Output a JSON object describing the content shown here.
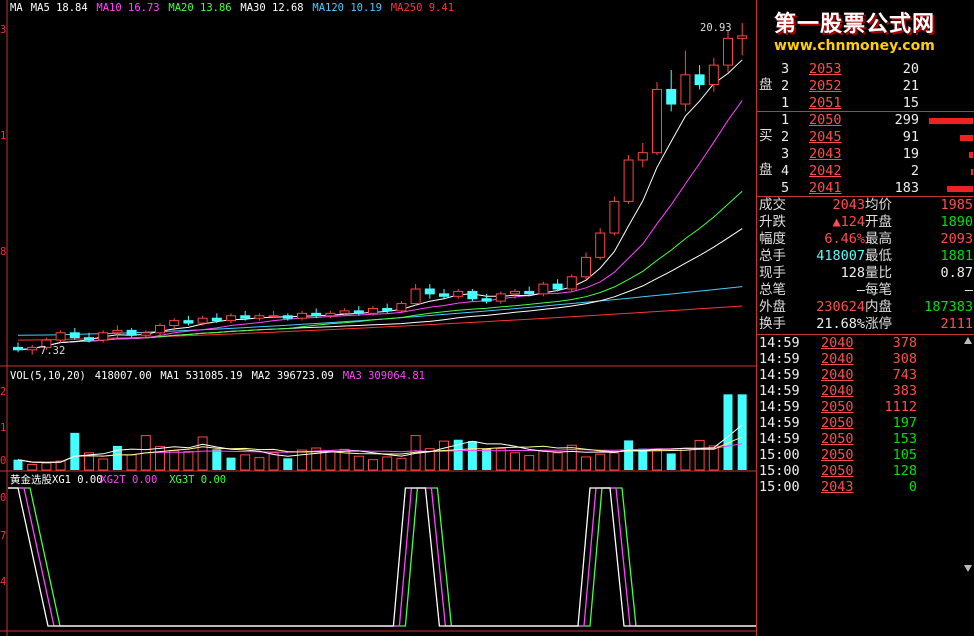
{
  "colors": {
    "up": "#ff4444",
    "down": "#44ffff",
    "ma5": "#ffffff",
    "ma10": "#ff44ff",
    "ma20": "#44ff44",
    "ma30": "#ffffff",
    "ma120": "#44ccff",
    "ma250": "#ff3333",
    "border": "#c33333"
  },
  "price_panel": {
    "legend": [
      {
        "text": "MA",
        "color": "#ffffff"
      },
      {
        "text": "MA5 18.84",
        "color": "#ffffff"
      },
      {
        "text": "MA10 16.73",
        "color": "#ff44ff"
      },
      {
        "text": "MA20 13.86",
        "color": "#44ff44"
      },
      {
        "text": "MA30 12.68",
        "color": "#ffffff"
      },
      {
        "text": "MA120 10.19",
        "color": "#44ccff"
      },
      {
        "text": "MA250 9.41",
        "color": "#ff3333"
      }
    ],
    "high_label": "20.93",
    "low_label": "7.32",
    "axis_labels": [
      "3",
      "1",
      "8"
    ]
  },
  "volume_panel": {
    "legend": [
      {
        "text": "VOL(5,10,20)",
        "color": "#ffffff"
      },
      {
        "text": "418007.00",
        "color": "#ffffff"
      },
      {
        "text": "MA1 531085.19",
        "color": "#ffffff"
      },
      {
        "text": "MA2 396723.09",
        "color": "#ffffff"
      },
      {
        "text": "MA3 309064.81",
        "color": "#ff44ff"
      }
    ],
    "axis_labels": [
      "2",
      "1",
      "0"
    ]
  },
  "indicator_panel": {
    "legend": [
      {
        "text": "黄金选股XG1 0.00",
        "color": "#ffffff"
      },
      {
        "text": "XG2T 0.00",
        "color": "#ff44ff"
      },
      {
        "text": "XG3T 0.00",
        "color": "#44ff44"
      }
    ],
    "axis_labels": [
      "0",
      "7",
      "4"
    ]
  },
  "chart_data": {
    "type": "candlestick",
    "candles": [
      [
        7.6,
        7.8,
        7.4,
        7.5
      ],
      [
        7.5,
        7.7,
        7.3,
        7.6
      ],
      [
        7.6,
        8.0,
        7.5,
        7.9
      ],
      [
        7.9,
        8.3,
        7.8,
        8.2
      ],
      [
        8.2,
        8.4,
        7.9,
        8.0
      ],
      [
        8.0,
        8.2,
        7.8,
        7.9
      ],
      [
        7.9,
        8.3,
        7.8,
        8.2
      ],
      [
        8.2,
        8.5,
        8.0,
        8.3
      ],
      [
        8.3,
        8.4,
        8.0,
        8.1
      ],
      [
        8.1,
        8.3,
        8.0,
        8.2
      ],
      [
        8.2,
        8.6,
        8.1,
        8.5
      ],
      [
        8.5,
        8.8,
        8.3,
        8.7
      ],
      [
        8.7,
        8.9,
        8.5,
        8.6
      ],
      [
        8.6,
        8.9,
        8.5,
        8.8
      ],
      [
        8.8,
        9.0,
        8.6,
        8.7
      ],
      [
        8.7,
        9.0,
        8.6,
        8.9
      ],
      [
        8.9,
        9.1,
        8.7,
        8.8
      ],
      [
        8.8,
        9.0,
        8.7,
        8.9
      ],
      [
        8.9,
        9.1,
        8.8,
        8.9
      ],
      [
        8.9,
        9.0,
        8.7,
        8.8
      ],
      [
        8.8,
        9.1,
        8.7,
        9.0
      ],
      [
        9.0,
        9.2,
        8.8,
        8.9
      ],
      [
        8.9,
        9.1,
        8.8,
        9.0
      ],
      [
        9.0,
        9.2,
        8.9,
        9.1
      ],
      [
        9.1,
        9.3,
        8.9,
        9.0
      ],
      [
        9.0,
        9.3,
        8.9,
        9.2
      ],
      [
        9.2,
        9.4,
        9.0,
        9.1
      ],
      [
        9.1,
        9.5,
        9.0,
        9.4
      ],
      [
        9.4,
        10.2,
        9.3,
        10.0
      ],
      [
        10.0,
        10.2,
        9.6,
        9.8
      ],
      [
        9.8,
        10.0,
        9.6,
        9.7
      ],
      [
        9.7,
        10.0,
        9.6,
        9.9
      ],
      [
        9.9,
        10.0,
        9.5,
        9.6
      ],
      [
        9.6,
        9.8,
        9.4,
        9.5
      ],
      [
        9.5,
        9.9,
        9.4,
        9.8
      ],
      [
        9.8,
        10.0,
        9.6,
        9.9
      ],
      [
        9.9,
        10.1,
        9.7,
        9.8
      ],
      [
        9.8,
        10.3,
        9.7,
        10.2
      ],
      [
        10.2,
        10.4,
        9.9,
        10.0
      ],
      [
        10.0,
        10.6,
        9.9,
        10.5
      ],
      [
        10.5,
        11.5,
        10.4,
        11.3
      ],
      [
        11.3,
        12.5,
        11.2,
        12.3
      ],
      [
        12.3,
        13.8,
        12.2,
        13.6
      ],
      [
        13.6,
        15.5,
        13.5,
        15.3
      ],
      [
        15.3,
        16.0,
        15.0,
        15.6
      ],
      [
        15.6,
        18.5,
        15.5,
        18.2
      ],
      [
        18.2,
        19.0,
        17.3,
        17.6
      ],
      [
        17.6,
        19.8,
        17.3,
        18.8
      ],
      [
        18.8,
        19.2,
        18.2,
        18.4
      ],
      [
        18.4,
        19.5,
        18.1,
        19.2
      ],
      [
        19.2,
        20.6,
        18.9,
        20.3
      ],
      [
        20.3,
        20.93,
        19.6,
        20.4
      ]
    ],
    "volume": [
      [
        150000,
        "down"
      ],
      [
        80000,
        "up"
      ],
      [
        100000,
        "up"
      ],
      [
        130000,
        "up"
      ],
      [
        540000,
        "down"
      ],
      [
        250000,
        "up"
      ],
      [
        160000,
        "up"
      ],
      [
        350000,
        "down"
      ],
      [
        220000,
        "up"
      ],
      [
        500000,
        "up"
      ],
      [
        340000,
        "up"
      ],
      [
        280000,
        "up"
      ],
      [
        270000,
        "up"
      ],
      [
        480000,
        "up"
      ],
      [
        300000,
        "down"
      ],
      [
        180000,
        "down"
      ],
      [
        220000,
        "up"
      ],
      [
        180000,
        "up"
      ],
      [
        250000,
        "up"
      ],
      [
        170000,
        "down"
      ],
      [
        290000,
        "up"
      ],
      [
        320000,
        "up"
      ],
      [
        280000,
        "up"
      ],
      [
        300000,
        "up"
      ],
      [
        200000,
        "up"
      ],
      [
        150000,
        "up"
      ],
      [
        190000,
        "up"
      ],
      [
        170000,
        "up"
      ],
      [
        500000,
        "up"
      ],
      [
        310000,
        "up"
      ],
      [
        420000,
        "up"
      ],
      [
        440000,
        "down"
      ],
      [
        420000,
        "down"
      ],
      [
        310000,
        "down"
      ],
      [
        310000,
        "up"
      ],
      [
        250000,
        "up"
      ],
      [
        210000,
        "up"
      ],
      [
        280000,
        "up"
      ],
      [
        250000,
        "up"
      ],
      [
        360000,
        "up"
      ],
      [
        190000,
        "up"
      ],
      [
        230000,
        "up"
      ],
      [
        250000,
        "up"
      ],
      [
        430000,
        "down"
      ],
      [
        310000,
        "down"
      ],
      [
        290000,
        "up"
      ],
      [
        240000,
        "down"
      ],
      [
        310000,
        "up"
      ],
      [
        430000,
        "up"
      ],
      [
        350000,
        "up"
      ],
      [
        1100000,
        "down"
      ],
      [
        1100000,
        "down"
      ]
    ],
    "indicator_spikes": [
      {
        "start": 1,
        "end": 4
      },
      {
        "start": 27,
        "end": 30
      },
      {
        "start": 40,
        "end": 43
      }
    ]
  },
  "quote": {
    "sell_label1": "盘",
    "buy_label1": "买",
    "buy_label2": "盘",
    "sell": [
      {
        "level": "3",
        "price": "2053",
        "volume": "20"
      },
      {
        "level": "2",
        "price": "2052",
        "volume": "21"
      },
      {
        "level": "1",
        "price": "2051",
        "volume": "15"
      }
    ],
    "buy": [
      {
        "level": "1",
        "price": "2050",
        "volume": "299",
        "bar": 100
      },
      {
        "level": "2",
        "price": "2045",
        "volume": "91",
        "bar": 30
      },
      {
        "level": "3",
        "price": "2043",
        "volume": "19",
        "bar": 8
      },
      {
        "level": "4",
        "price": "2042",
        "volume": "2",
        "bar": 3
      },
      {
        "level": "5",
        "price": "2041",
        "volume": "183",
        "bar": 60
      }
    ],
    "stats": [
      {
        "l1": "成交",
        "v1": "2043",
        "c1": "red",
        "l2": "均价",
        "v2": "1985",
        "c2": "red"
      },
      {
        "l1": "升跌",
        "v1": "▲124",
        "c1": "red",
        "l2": "开盘",
        "v2": "1890",
        "c2": "green"
      },
      {
        "l1": "幅度",
        "v1": "6.46%",
        "c1": "red",
        "l2": "最高",
        "v2": "2093",
        "c2": "red"
      },
      {
        "l1": "总手",
        "v1": "418007",
        "c1": "cyan",
        "l2": "最低",
        "v2": "1881",
        "c2": "green"
      },
      {
        "l1": "现手",
        "v1": "128",
        "c1": "white",
        "l2": "量比",
        "v2": "0.87",
        "c2": "white"
      },
      {
        "l1": "总笔",
        "v1": "—",
        "c1": "white",
        "l2": "每笔",
        "v2": "—",
        "c2": "white"
      },
      {
        "l1": "外盘",
        "v1": "230624",
        "c1": "red",
        "l2": "内盘",
        "v2": "187383",
        "c2": "green"
      },
      {
        "l1": "换手",
        "v1": "21.68%",
        "c1": "white",
        "l2": "涨停",
        "v2": "2111",
        "c2": "red"
      }
    ],
    "ticks": [
      {
        "time": "14:59",
        "price": "2040",
        "volume": "378",
        "vc": "red"
      },
      {
        "time": "14:59",
        "price": "2040",
        "volume": "308",
        "vc": "red"
      },
      {
        "time": "14:59",
        "price": "2040",
        "volume": "743",
        "vc": "red"
      },
      {
        "time": "14:59",
        "price": "2040",
        "volume": "383",
        "vc": "red"
      },
      {
        "time": "14:59",
        "price": "2050",
        "volume": "1112",
        "vc": "red"
      },
      {
        "time": "14:59",
        "price": "2050",
        "volume": "197",
        "vc": "green"
      },
      {
        "time": "14:59",
        "price": "2050",
        "volume": "153",
        "vc": "green"
      },
      {
        "time": "15:00",
        "price": "2050",
        "volume": "105",
        "vc": "green"
      },
      {
        "time": "15:00",
        "price": "2050",
        "volume": "128",
        "vc": "green"
      },
      {
        "time": "15:00",
        "price": "2043",
        "volume": "0",
        "vc": "green"
      }
    ]
  },
  "watermark": {
    "title": "第一股票公式网",
    "url": "www.chnmoney.com"
  }
}
